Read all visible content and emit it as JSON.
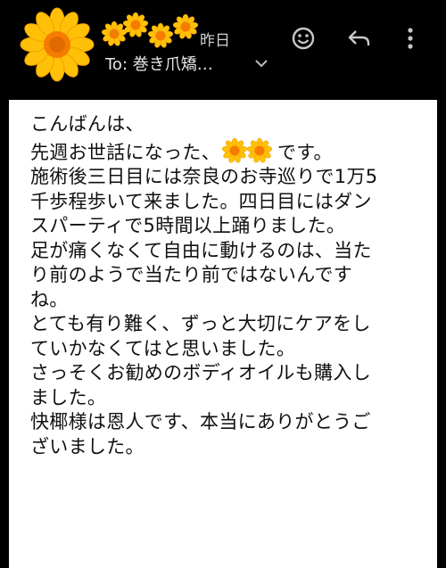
{
  "header": {
    "date": "昨日",
    "to": "To: 巻き爪矯…",
    "icons": {
      "avatar": "sunflower-avatar",
      "emoji": "emoji-icon",
      "reply": "reply-icon",
      "more": "more-vert-icon",
      "expand": "chevron-down-icon"
    }
  },
  "message": {
    "lines": [
      "こんばんは、",
      "先週お世話になった、",
      "です。",
      "施術後三日目には奈良のお寺巡りで1万5",
      "千歩程歩いて来ました。四日目にはダン",
      "スパーティで5時間以上踊りました。",
      "足が痛くなくて自由に動けるのは、当た",
      "り前のようで当たり前ではないんです",
      "ね。",
      "とても有り難く、ずっと大切にケアをし",
      "ていかなくてはと思いました。",
      "さっそくお勧めのボディオイルも購入し",
      "ました。",
      "快椰様は恩人です、本当にありがとうご",
      "ざいました。"
    ]
  },
  "colors": {
    "background": "#000000",
    "card": "#ffffff",
    "text": "#111111",
    "sunflower_petal": "#ffc107",
    "sunflower_center": "#f57c00"
  }
}
